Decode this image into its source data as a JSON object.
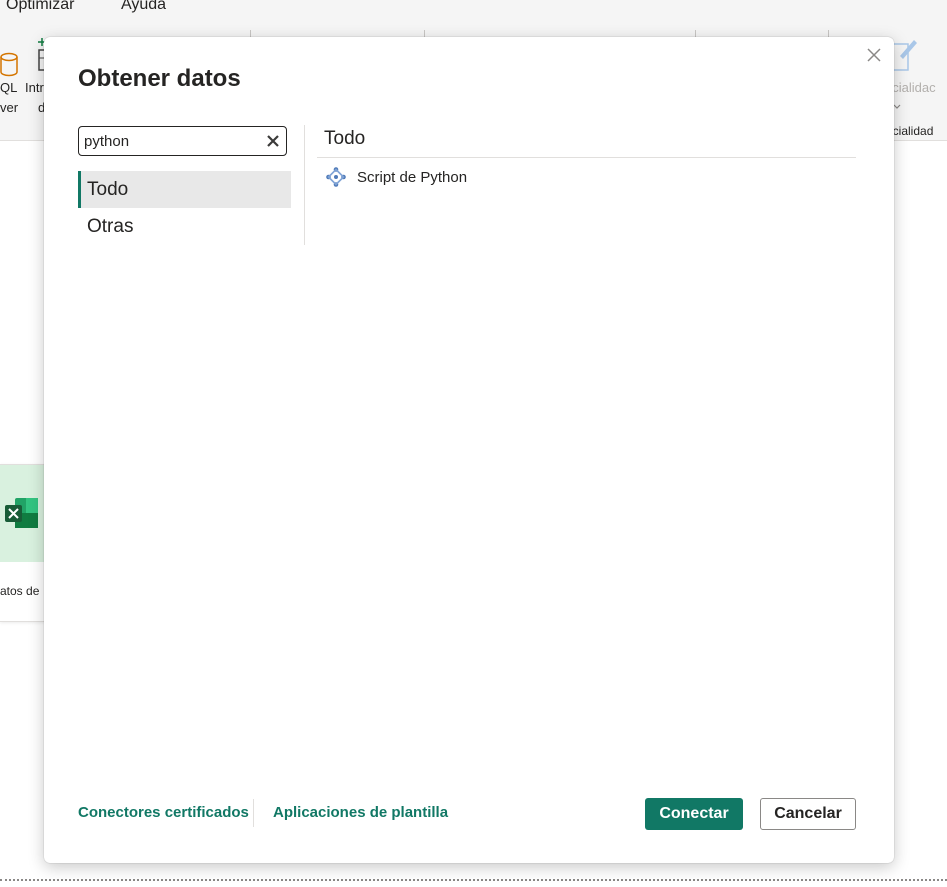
{
  "app": {
    "menu": [
      "Optimizar",
      "Ayuda"
    ],
    "ribbon": {
      "sql_label_1": "QL",
      "sql_label_2": "ver",
      "enter_label_1": "Intr",
      "enter_label_2": "d",
      "sensitivity_label": "ncialidad",
      "sensitivity_faded": "ncialidac"
    },
    "card_caption": "atos de",
    "colors": {
      "accent": "#117865",
      "excel_green": "#107c41",
      "selected_bg": "#e8e8e8"
    }
  },
  "dialog": {
    "title": "Obtener datos",
    "close_icon": "close-icon",
    "search": {
      "value": "python",
      "placeholder": "",
      "clear_icon": "clear-icon"
    },
    "categories": [
      {
        "label": "Todo",
        "selected": true
      },
      {
        "label": "Otras",
        "selected": false
      }
    ],
    "section_title": "Todo",
    "results": [
      {
        "label": "Script de Python",
        "icon": "python-script-icon"
      }
    ],
    "footer": {
      "link_certified": "Conectores certificados",
      "link_templates": "Aplicaciones de plantilla",
      "connect_label": "Conectar",
      "cancel_label": "Cancelar"
    }
  }
}
